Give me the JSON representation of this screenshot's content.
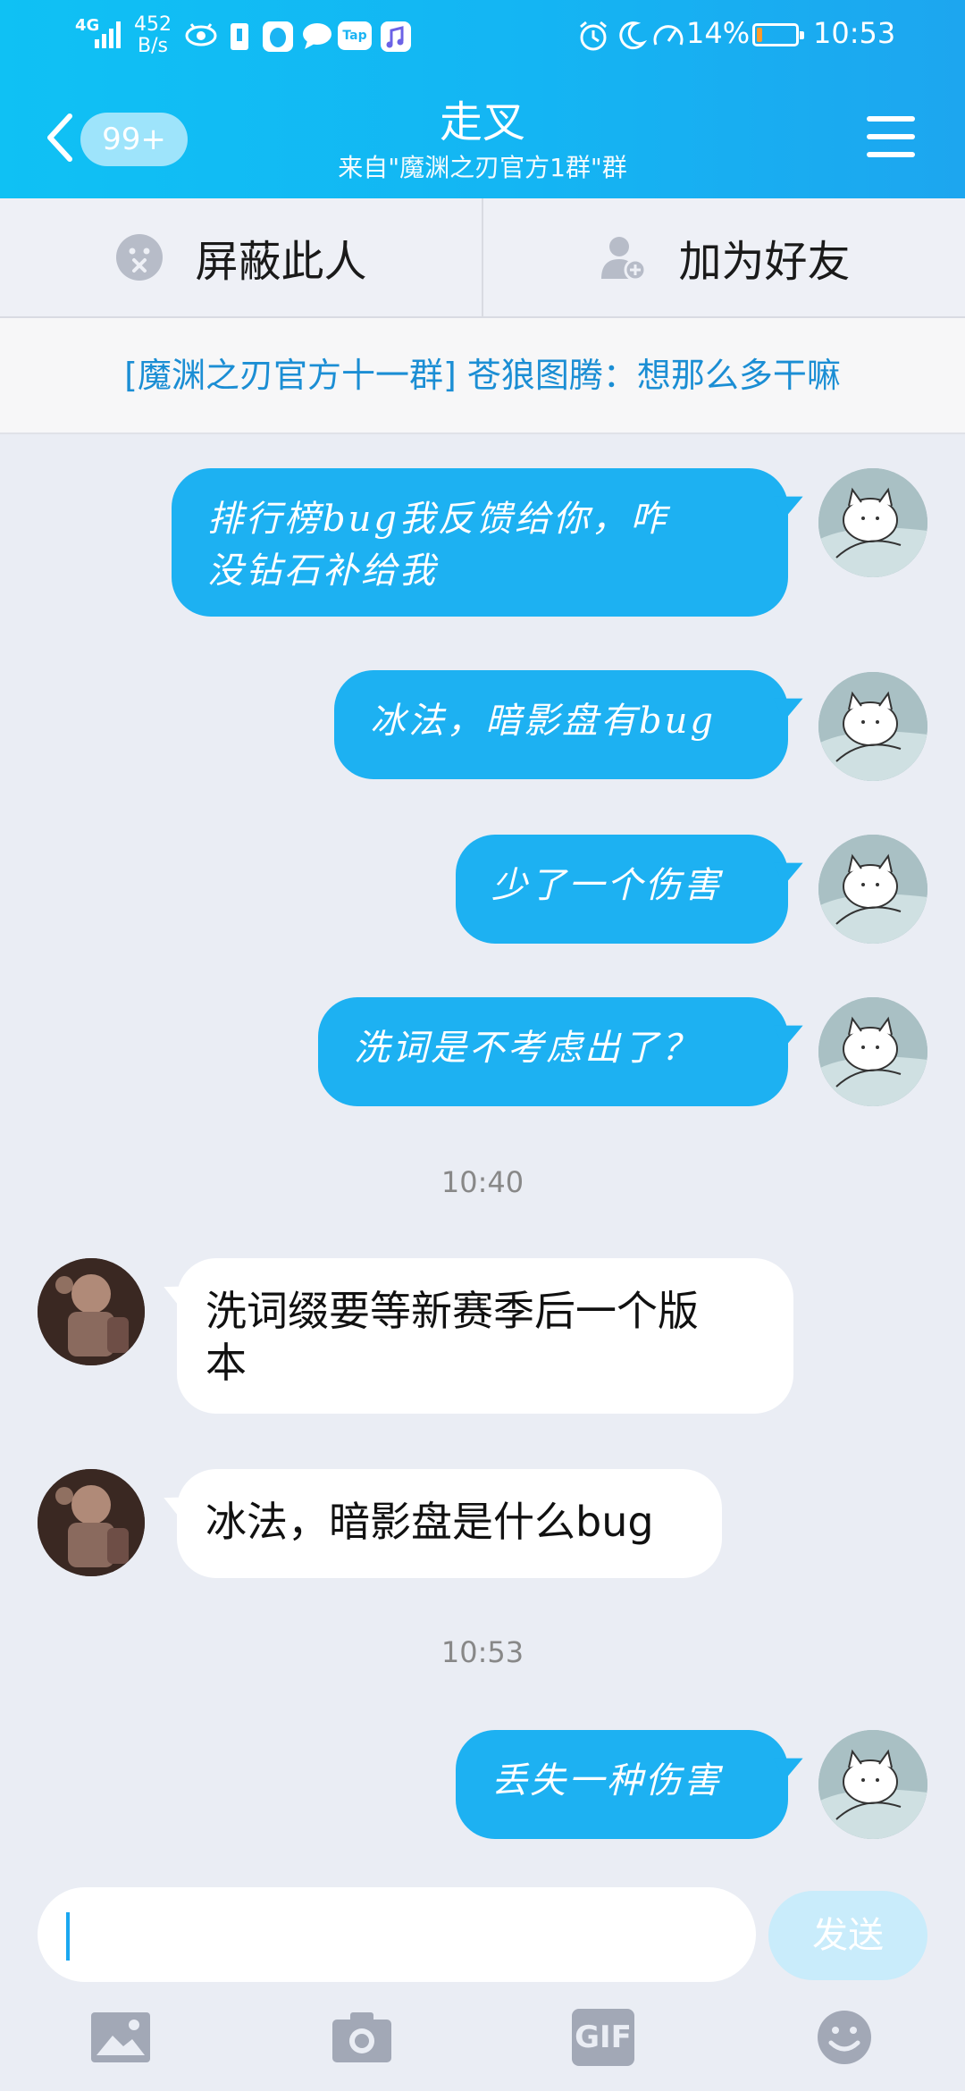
{
  "status_bar": {
    "network": "4G",
    "speed_value": "452",
    "speed_unit": "B/s",
    "app_icon_tap": "Tap",
    "battery_percent": "14%",
    "time": "10:53",
    "battery_level": 0.14
  },
  "header": {
    "unread_badge": "99+",
    "title": "走叉",
    "subtitle": "来自\"魔渊之刃官方1群\"群"
  },
  "actions": {
    "block_label": "屏蔽此人",
    "add_friend_label": "加为好友"
  },
  "notice": {
    "text": "[魔渊之刃官方十一群] 苍狼图腾：想那么多干嘛"
  },
  "messages": [
    {
      "side": "out",
      "line1": "排行榜bug我反馈给你，咋",
      "line2": "没钻石补给我"
    },
    {
      "side": "out",
      "text": "冰法，暗影盘有bug"
    },
    {
      "side": "out",
      "text": "少了一个伤害"
    },
    {
      "side": "out",
      "text": "洗词是不考虑出了？"
    },
    {
      "side": "time",
      "text": "10:40"
    },
    {
      "side": "in",
      "line1": "洗词缀要等新赛季后一个版",
      "line2": "本"
    },
    {
      "side": "in",
      "text": "冰法，暗影盘是什么bug"
    },
    {
      "side": "time",
      "text": "10:53"
    },
    {
      "side": "out",
      "text": "丢失一种伤害"
    }
  ],
  "composer": {
    "send_label": "发送"
  },
  "toolbar": {
    "gif_label": "GIF"
  },
  "colors": {
    "header_gradient_start": "#0fc1f4",
    "header_gradient_end": "#1da6ef",
    "outgoing_bubble": "#1db1f2",
    "incoming_bubble": "#ffffff",
    "notice_text": "#1b8ed4",
    "background": "#eaedf4"
  },
  "icons": [
    "back-chevron-icon",
    "menu-icon",
    "block-user-icon",
    "add-friend-icon",
    "photo-icon",
    "camera-icon",
    "gif-icon",
    "emoji-icon"
  ]
}
